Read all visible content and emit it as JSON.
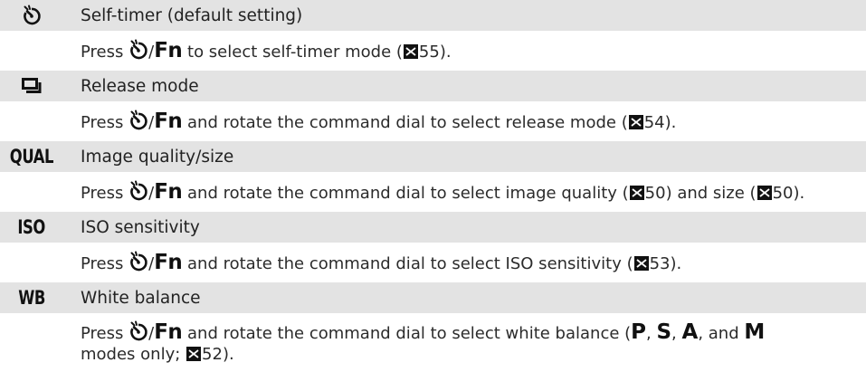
{
  "rows": [
    {
      "icon": "self-timer-icon",
      "title": "Self-timer (default setting)",
      "desc": {
        "press": "Press",
        "slash": "/",
        "fn": "Fn",
        "after": "to select self-timer mode (",
        "ref": "55",
        "close": ")."
      }
    },
    {
      "icon": "release-mode-icon",
      "title": "Release mode",
      "desc": {
        "press": "Press",
        "slash": "/",
        "fn": "Fn",
        "after": "and rotate the command dial to select release mode (",
        "ref": "54",
        "close": ")."
      }
    },
    {
      "icon_text": "QUAL",
      "title": "Image quality/size",
      "desc": {
        "press": "Press",
        "slash": "/",
        "fn": "Fn",
        "after": "and rotate the command dial to select image quality (",
        "ref1": "50",
        "mid": ") and size (",
        "ref2": "50",
        "close": ")."
      }
    },
    {
      "icon_text": "ISO",
      "title": "ISO sensitivity",
      "desc": {
        "press": "Press",
        "slash": "/",
        "fn": "Fn",
        "after": "and rotate the command dial to select ISO sensitivity (",
        "ref": "53",
        "close": ")."
      }
    },
    {
      "icon_text": "WB",
      "title": "White balance",
      "desc": {
        "press": "Press",
        "slash": "/",
        "fn": "Fn",
        "after": "and rotate the command dial to select white balance (",
        "mode_p": "P",
        "comma1": ", ",
        "mode_s": "S",
        "comma2": ", ",
        "mode_a": "A",
        "and": ", and",
        "mode_m": "M",
        "line2": "modes only;",
        "ref": "52",
        "close": ")."
      }
    }
  ],
  "colors": {
    "header_bg": "#e3e3e3",
    "text": "#222222"
  }
}
